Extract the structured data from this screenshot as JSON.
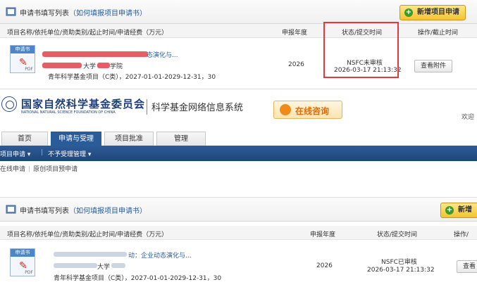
{
  "top_panel": {
    "title": "申请书填写列表",
    "help": "（如何填报项目申请书）",
    "add_button": "新增项目申请",
    "columns": [
      "项目名称/依托单位/资助类别/起止时间/申请经费（万元）",
      "申报年度",
      "状态/提交时间",
      "操作/截止时间"
    ],
    "row": {
      "doc_tag": "申请书",
      "doc_pdf": "PDF",
      "name_tail": "态演化与...",
      "unit_part1": "大学",
      "unit_part2": "学院",
      "project_line": "青年科学基金项目（C类），2027-01-01-2029-12-31，30",
      "year": "2026",
      "status": "NSFC未审核",
      "submit_time": "2026-03-17 21:13:32",
      "action": "查看附件"
    }
  },
  "header": {
    "org_cn": "国家自然科学基金委员会",
    "org_en": "NATIONAL NATURAL SCIENCE FOUNDATION OF CHINA",
    "system_name": "科学基金网络信息系统",
    "consult": "在线咨询",
    "welcome": "欢迎"
  },
  "tabs": [
    {
      "label": "首页"
    },
    {
      "label": "申请与受理"
    },
    {
      "label": "项目批准"
    },
    {
      "label": "管理"
    }
  ],
  "nav": {
    "item1": "项目申请",
    "item2": "不予受理管理"
  },
  "subnav": {
    "item1": "在线申请",
    "item2": "原创项目预申请"
  },
  "bottom_panel": {
    "title": "申请书填写列表",
    "help": "（如何填报项目申请书）",
    "add_button": "新增",
    "columns": [
      "项目名称/依托单位/资助类别/起止时间/申请经费（万元）",
      "申报年度",
      "状态/提交时间",
      "操作/"
    ],
    "row": {
      "doc_tag": "申请书",
      "doc_pdf": "PDF",
      "name_tail": "动：企业动态演化与...",
      "unit_part": "大学",
      "project_line": "青年科学基金项目（C类），2027-01-01-2029-12-31，30",
      "year": "2026",
      "status": "NSFC已审核",
      "submit_time": "2026-03-17 21:13:32",
      "action": "查看"
    }
  },
  "colors": {
    "accent_blue": "#2a5c9a",
    "highlight_red": "#e2383f",
    "redaction_red": "#e4414a"
  }
}
